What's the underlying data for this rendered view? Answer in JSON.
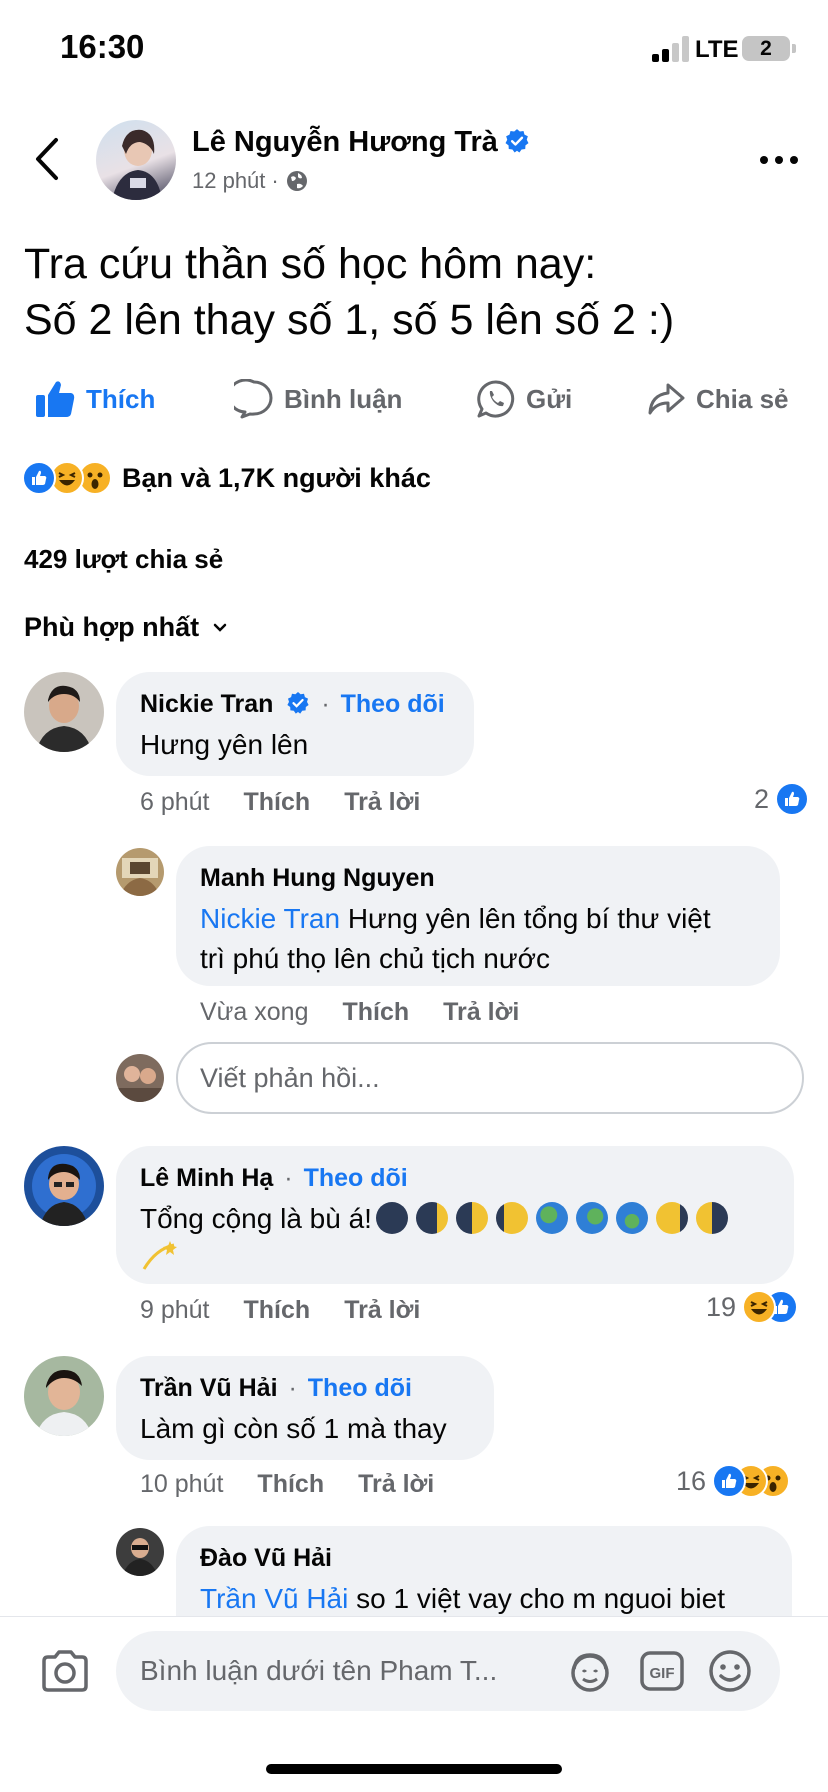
{
  "status_bar": {
    "time": "16:30",
    "network": "LTE",
    "battery": "2"
  },
  "post": {
    "author": "Lê Nguyễn Hương Trà",
    "time": "12 phút",
    "separator": "·",
    "text_lines": [
      "Tra cứu thần số học hôm nay:",
      "Số 2 lên thay số 1, số 5 lên số 2 :)"
    ]
  },
  "actions": {
    "like": "Thích",
    "comment": "Bình luận",
    "send": "Gửi",
    "share": "Chia sẻ"
  },
  "reactions": {
    "summary": "Bạn và 1,7K người khác",
    "icons": [
      "like-icon",
      "haha-icon",
      "wow-icon"
    ]
  },
  "shares": "429 lượt chia sẻ",
  "sort": "Phù hợp nhất",
  "comments": [
    {
      "name": "Nickie Tran",
      "follow": "Theo dõi",
      "text": "Hưng yên lên",
      "time": "6 phút",
      "like": "Thích",
      "reply": "Trả lời",
      "reaction_count": "2"
    },
    {
      "name": "Manh Hung Nguyen",
      "mention": "Nickie Tran",
      "text_line1": " Hưng yên lên tổng bí thư việt",
      "text_line2": "trì phú thọ lên chủ tịch nước",
      "time": "Vừa xong",
      "like": "Thích",
      "reply": "Trả lời"
    },
    {
      "name": "Lê Minh Hạ",
      "follow": "Theo dõi",
      "text": "Tổng cộng là bù á!",
      "emoji": [
        "new-moon",
        "waxing-crescent",
        "first-quarter",
        "waxing-gibbous",
        "globe",
        "globe",
        "globe",
        "waning-gibbous",
        "last-quarter",
        "dizzy-star"
      ],
      "time": "9 phút",
      "like": "Thích",
      "reply": "Trả lời",
      "reaction_count": "19"
    },
    {
      "name": "Trần Vũ Hải",
      "follow": "Theo dõi",
      "text": "Làm gì còn số 1 mà thay",
      "time": "10 phút",
      "like": "Thích",
      "reply": "Trả lời",
      "reaction_count": "16"
    },
    {
      "name": "Đào Vũ Hải",
      "mention": "Trần Vũ Hải",
      "text": " so 1 việt vay cho m nguoi biet"
    }
  ],
  "reply_placeholder": "Viết phản hồi...",
  "composer_placeholder": "Bình luận dưới tên Pham T...",
  "colors": {
    "brand_blue": "#1877f2",
    "bubble": "#f0f2f5",
    "secondary_text": "#65676b"
  }
}
